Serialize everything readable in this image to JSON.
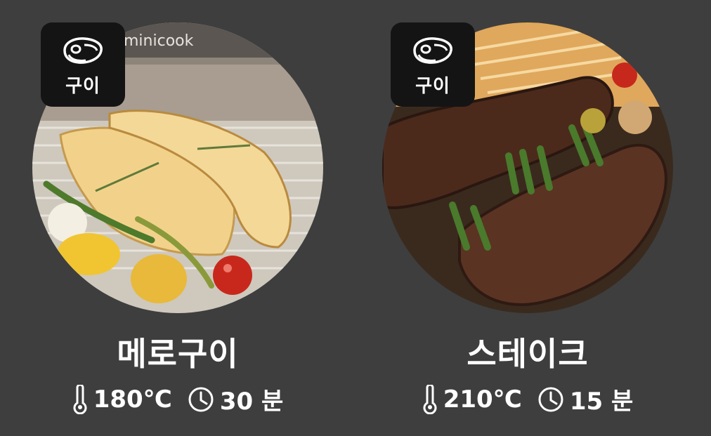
{
  "colors": {
    "background": "#3e3e3e",
    "badge": "#141414",
    "text": "#ffffff"
  },
  "cards": [
    {
      "badge_icon": "steak-icon",
      "badge_label": "구이",
      "photo": "grilled-fish-photo",
      "name": "메로구이",
      "temperature_icon": "thermometer-icon",
      "temperature": "180℃",
      "time_icon": "clock-icon",
      "time": "30 분",
      "photo_watermark": "minicook"
    },
    {
      "badge_icon": "steak-icon",
      "badge_label": "구이",
      "photo": "grilled-steak-photo",
      "name": "스테이크",
      "temperature_icon": "thermometer-icon",
      "temperature": "210℃",
      "time_icon": "clock-icon",
      "time": "15 분"
    }
  ]
}
